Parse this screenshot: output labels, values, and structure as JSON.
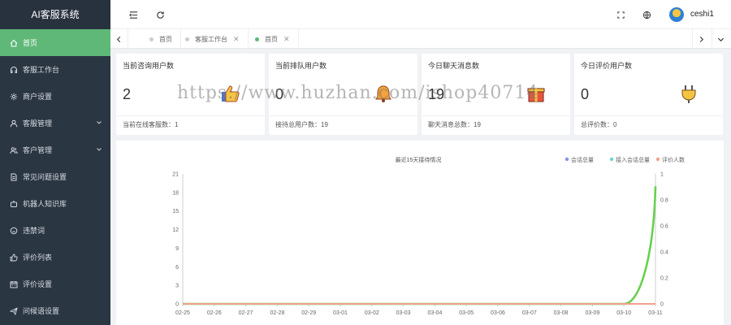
{
  "sidebar": {
    "brand": "AI客服系统",
    "items": [
      {
        "label": "首页",
        "icon": "home-icon",
        "active": true
      },
      {
        "label": "客服工作台",
        "icon": "headset-icon"
      },
      {
        "label": "商户设置",
        "icon": "gear-icon"
      },
      {
        "label": "客服管理",
        "icon": "user-icon",
        "expandable": true
      },
      {
        "label": "客户管理",
        "icon": "users-icon",
        "expandable": true
      },
      {
        "label": "常见问题设置",
        "icon": "document-icon"
      },
      {
        "label": "机器人知识库",
        "icon": "robot-icon"
      },
      {
        "label": "违禁词",
        "icon": "ban-icon"
      },
      {
        "label": "评价列表",
        "icon": "thumbs-up-icon"
      },
      {
        "label": "评价设置",
        "icon": "calendar-icon"
      },
      {
        "label": "问候语设置",
        "icon": "send-icon"
      }
    ]
  },
  "header": {
    "username": "ceshi1",
    "icons": [
      "menu-fold-icon",
      "refresh-icon",
      "fullscreen-icon",
      "globe-icon"
    ]
  },
  "tabs": [
    {
      "label": "首页"
    },
    {
      "label": "客服工作台",
      "closable": true
    },
    {
      "label": "首页",
      "closable": true,
      "active": true
    }
  ],
  "cards": [
    {
      "title": "当前咨询用户数",
      "value": "2",
      "footer": "当前在线客服数：1",
      "icon": "thumbs-up-icon"
    },
    {
      "title": "当前排队用户数",
      "value": "0",
      "footer": "接待总用户数：19",
      "icon": "bell-icon"
    },
    {
      "title": "今日聊天消息数",
      "value": "19",
      "footer": "聊天消息总数：19",
      "icon": "gift-icon"
    },
    {
      "title": "今日评价用户数",
      "value": "0",
      "footer": "总评价数：0",
      "icon": "plug-icon"
    }
  ],
  "watermark": "https://www.huzhan.com/ishop40714",
  "chart_data": {
    "type": "line",
    "title": "最近15天接待情况",
    "categories": [
      "02-25",
      "02-26",
      "02-27",
      "02-28",
      "02-29",
      "03-01",
      "03-02",
      "03-03",
      "03-04",
      "03-05",
      "03-06",
      "03-07",
      "03-08",
      "03-09",
      "03-10",
      "03-11"
    ],
    "series": [
      {
        "name": "会话总量",
        "axis": "left",
        "color": "#8b93e6",
        "values": [
          0,
          0,
          0,
          0,
          0,
          0,
          0,
          0,
          0,
          0,
          0,
          0,
          0,
          0,
          0,
          19
        ]
      },
      {
        "name": "接入会话总量",
        "axis": "left",
        "color": "#6fd3d8",
        "values": [
          0,
          0,
          0,
          0,
          0,
          0,
          0,
          0,
          0,
          0,
          0,
          0,
          0,
          0,
          0,
          19
        ]
      },
      {
        "name": "评价人数",
        "axis": "right",
        "color": "#f2a08f",
        "values": [
          0,
          0,
          0,
          0,
          0,
          0,
          0,
          0,
          0,
          0,
          0,
          0,
          0,
          0,
          0,
          0
        ]
      }
    ],
    "highlight_color": "#67d14f",
    "y_left": {
      "min": 0,
      "max": 21,
      "ticks": [
        0,
        3,
        6,
        9,
        12,
        15,
        18,
        21
      ]
    },
    "y_right": {
      "min": 0,
      "max": 1,
      "ticks": [
        0,
        0.2,
        0.4,
        0.6,
        0.8,
        1
      ]
    },
    "legend": "top-right"
  }
}
